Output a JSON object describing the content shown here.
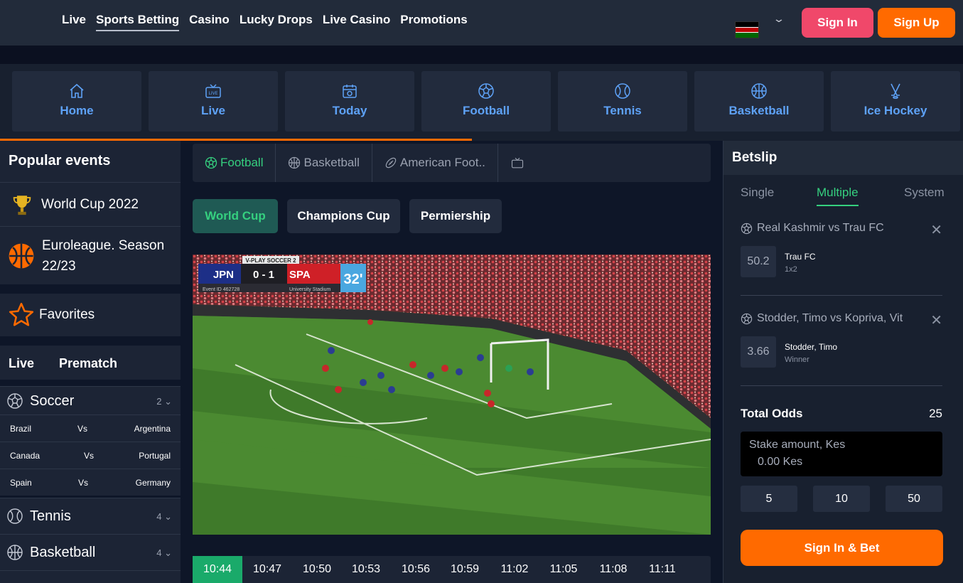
{
  "nav": {
    "items": [
      "Live",
      "Sports Betting",
      "Casino",
      "Lucky Drops",
      "Live Casino",
      "Promotions"
    ],
    "active": "Sports Betting",
    "sign_in": "Sign In",
    "sign_up": "Sign Up"
  },
  "categories": [
    {
      "label": "Home",
      "icon": "home-icon"
    },
    {
      "label": "Live",
      "icon": "live-tv-icon"
    },
    {
      "label": "Today",
      "icon": "calendar-icon"
    },
    {
      "label": "Football",
      "icon": "football-icon"
    },
    {
      "label": "Tennis",
      "icon": "tennis-ball-icon"
    },
    {
      "label": "Basketball",
      "icon": "basketball-icon"
    },
    {
      "label": "Ice Hockey",
      "icon": "hockey-sticks-icon"
    }
  ],
  "sidebar": {
    "title": "Popular events",
    "events": [
      "World Cup 2022",
      "Euroleague. Season 22/23"
    ],
    "favorites": "Favorites",
    "tabs": [
      "Live",
      "Prematch"
    ],
    "sports": [
      {
        "name": "Soccer",
        "count": "2"
      },
      {
        "name": "Tennis",
        "count": "4"
      },
      {
        "name": "Basketball",
        "count": "4"
      }
    ],
    "matches": [
      {
        "home": "Brazil",
        "vs": "Vs",
        "away": "Argentina"
      },
      {
        "home": "Canada",
        "vs": "Vs",
        "away": "Portugal"
      },
      {
        "home": "Spain",
        "vs": "Vs",
        "away": "Germany"
      }
    ]
  },
  "center": {
    "sport_tabs": [
      "Football",
      "Basketball",
      "American Foot.."
    ],
    "active_sport": "Football",
    "chips": [
      "World Cup",
      "Champions Cup",
      "Permiership"
    ],
    "active_chip": "World Cup",
    "scoreboard": {
      "brand": "V-PLAY SOCCER 2",
      "home": "JPN",
      "score": "0 - 1",
      "away": "SPA",
      "minute": "32'",
      "event": "Event ID 462728",
      "venue": "University Stadium"
    },
    "times": [
      "10:44",
      "10:47",
      "10:50",
      "10:53",
      "10:56",
      "10:59",
      "11:02",
      "11:05",
      "11:08",
      "11:11"
    ],
    "active_time": "10:44"
  },
  "betslip": {
    "title": "Betslip",
    "tabs": [
      "Single",
      "Multiple",
      "System"
    ],
    "active_tab": "Multiple",
    "selections": [
      {
        "match": "Real Kashmir vs Trau FC",
        "odd": "50.2",
        "pick": "Trau FC",
        "market": "1x2"
      },
      {
        "match": "Stodder, Timo vs Kopriva, Vit",
        "odd": "3.66",
        "pick": "Stodder, Timo",
        "market": "Winner"
      }
    ],
    "total_label": "Total Odds",
    "total_value": "25",
    "stake_label": "Stake amount, Kes",
    "stake_value": "0.00 Kes",
    "quick_stakes": [
      "5",
      "10",
      "50"
    ],
    "bet_button": "Sign In & Bet"
  },
  "colors": {
    "accent_orange": "#ff6a00",
    "accent_pink": "#f0486a",
    "accent_green": "#35d07f",
    "link_blue": "#5ea2f7"
  }
}
